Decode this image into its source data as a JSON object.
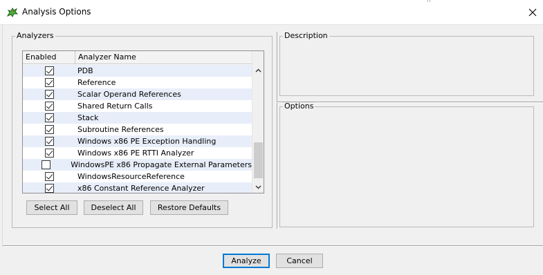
{
  "window": {
    "title": "Analysis Options",
    "close_glyph": "✕",
    "app_icon": "dragon-icon"
  },
  "analyzers": {
    "group_label": "Analyzers",
    "columns": [
      "Enabled",
      "Analyzer Name"
    ],
    "rows": [
      {
        "name": "PDB",
        "enabled": true
      },
      {
        "name": "Reference",
        "enabled": true
      },
      {
        "name": "Scalar Operand References",
        "enabled": true
      },
      {
        "name": "Shared Return Calls",
        "enabled": true
      },
      {
        "name": "Stack",
        "enabled": true
      },
      {
        "name": "Subroutine References",
        "enabled": true
      },
      {
        "name": "Windows x86 PE Exception Handling",
        "enabled": true
      },
      {
        "name": "Windows x86 PE RTTI Analyzer",
        "enabled": true
      },
      {
        "name": "WindowsPE x86 Propagate External Parameters",
        "enabled": false
      },
      {
        "name": "WindowsResourceReference",
        "enabled": true
      },
      {
        "name": "x86 Constant Reference Analyzer",
        "enabled": true
      }
    ],
    "buttons": {
      "select_all": "Select All",
      "deselect_all": "Deselect All",
      "restore_defaults": "Restore Defaults"
    }
  },
  "description": {
    "group_label": "Description"
  },
  "options": {
    "group_label": "Options"
  },
  "footer": {
    "analyze": "Analyze",
    "cancel": "Cancel"
  },
  "colors": {
    "row_alt": "#e8eef9",
    "default_button_border": "#0078d7"
  }
}
